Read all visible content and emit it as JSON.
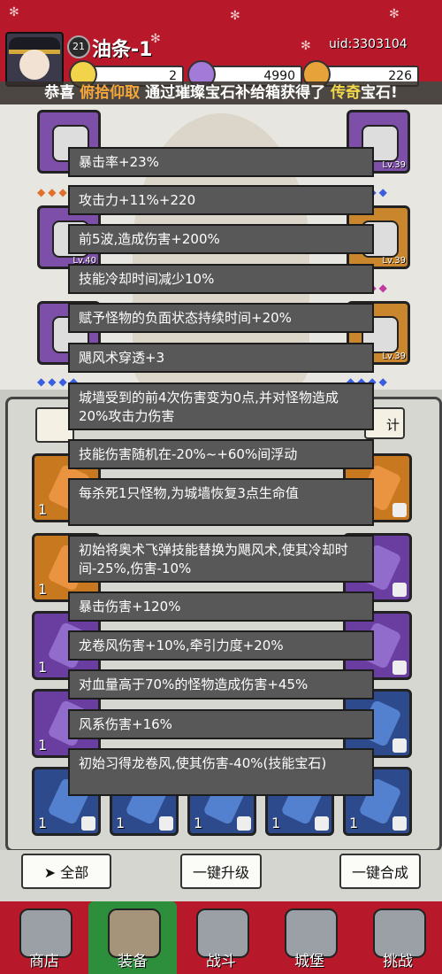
{
  "header": {
    "level": "21",
    "username": "油条-1",
    "uid": "uid:3303104",
    "resources": [
      {
        "name": "gold-coin-icon",
        "value": "2",
        "color": "#f2d44a"
      },
      {
        "name": "purple-gem-icon",
        "value": "4990",
        "color": "#a47ad8"
      },
      {
        "name": "energy-icon",
        "value": "226",
        "color": "#e8a23a"
      }
    ]
  },
  "banner": {
    "prefix": "恭喜 ",
    "player": "俯拾仰取",
    "middle": " 通过璀璨宝石补给箱获得了 ",
    "rarity": "传奇",
    "suffix": "宝石!"
  },
  "equipment": {
    "slots": [
      {
        "name": "helmet-slot",
        "level": ""
      },
      {
        "name": "gloves-slot",
        "level": "Lv.39"
      },
      {
        "name": "armor-slot",
        "level": "Lv.40"
      },
      {
        "name": "necklace-slot",
        "level": "Lv.39"
      },
      {
        "name": "boots-slot",
        "level": ""
      },
      {
        "name": "ring-slot",
        "level": "Lv.39"
      }
    ]
  },
  "stats_button": "计",
  "gem_count": "1",
  "tooltip": [
    "暴击率+23%",
    "攻击力+11%+220",
    "前5波,造成伤害+200%",
    "技能冷却时间减少10%",
    "赋予怪物的负面状态持续时间+20%",
    "飓风术穿透+3",
    "城墙受到的前4次伤害变为0点,并对怪物造成20%攻击力伤害",
    "技能伤害随机在-20%~+60%间浮动",
    "每杀死1只怪物,为城墙恢复3点生命值",
    "初始将奥术飞弹技能替换为飓风术,使其冷却时间-25%,伤害-10%",
    "暴击伤害+120%",
    "龙卷风伤害+10%,牵引力度+20%",
    "对血量高于70%的怪物造成伤害+45%",
    "风系伤害+16%",
    "初始习得龙卷风,使其伤害-40%(技能宝石)"
  ],
  "actions": {
    "all": "全部",
    "upgrade": "一键升级",
    "merge": "一键合成"
  },
  "nav": [
    "商店",
    "装备",
    "战斗",
    "城堡",
    "挑战"
  ]
}
